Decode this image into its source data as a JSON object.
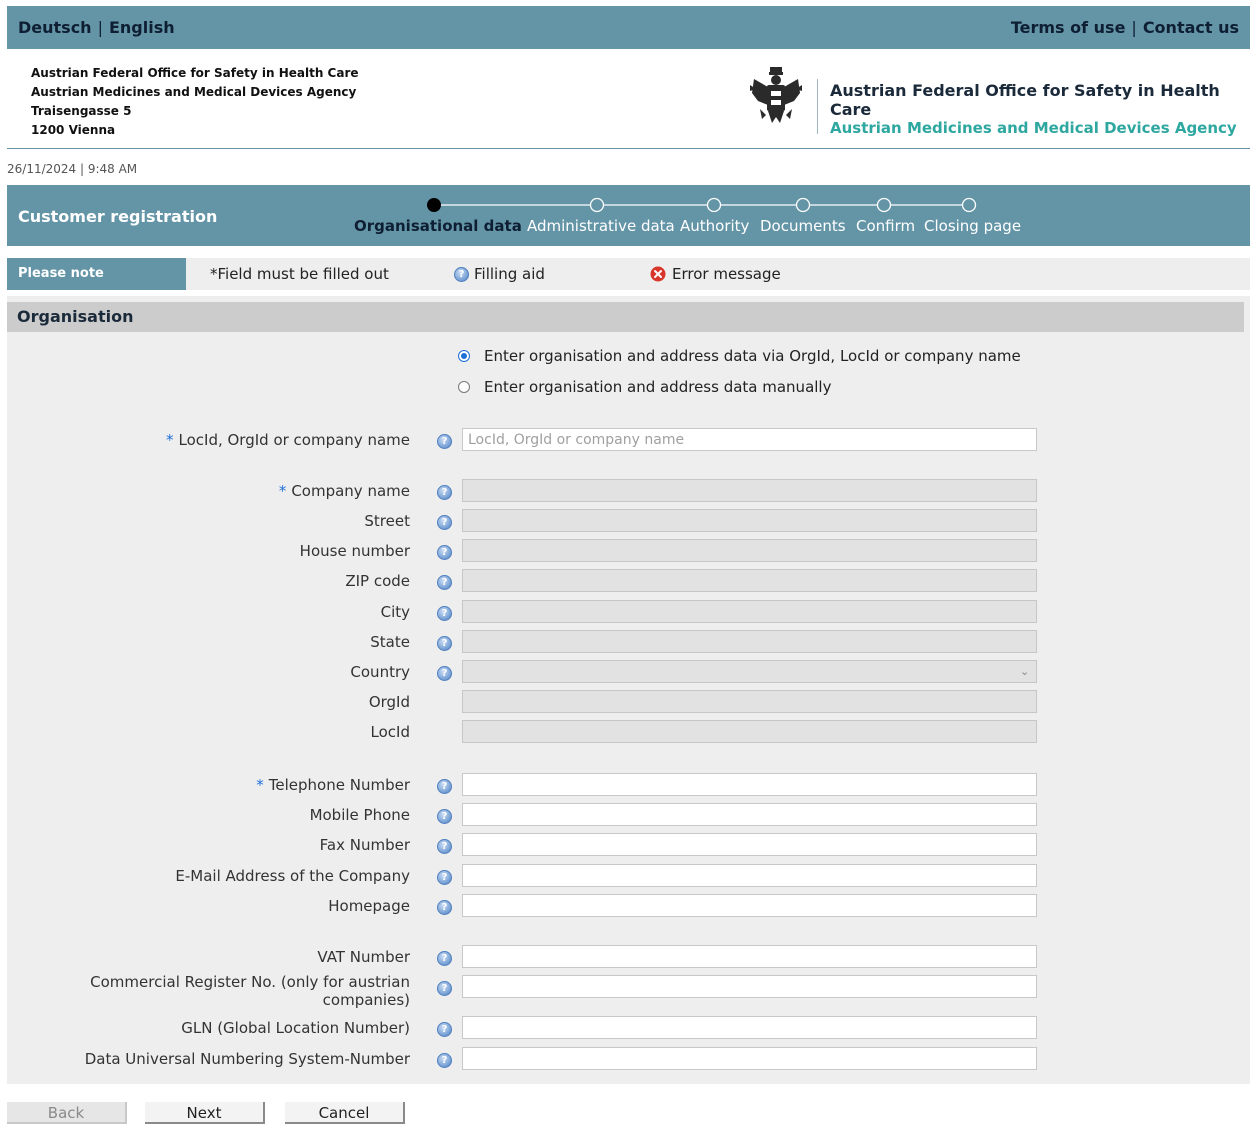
{
  "topbar": {
    "lang_de": "Deutsch",
    "lang_sep": "|",
    "lang_en": "English",
    "terms": "Terms of use",
    "link_sep": "|",
    "contact": "Contact us",
    "color": "#6495a7"
  },
  "header": {
    "address": [
      "Austrian Federal Office for Safety in Health Care",
      "Austrian Medicines and Medical Devices Agency",
      "Traisengasse 5",
      "1200 Vienna"
    ],
    "agency_line1": "Austrian Federal Office for Safety in Health Care",
    "agency_line2": "Austrian Medicines and Medical Devices Agency",
    "logo_icon": "austrian-eagle-coat-of-arms-icon"
  },
  "datetime": "26/11/2024 | 9:48 AM",
  "wizard": {
    "title": "Customer registration",
    "steps": [
      {
        "label": "Organisational data",
        "active": true
      },
      {
        "label": "Administrative data",
        "active": false
      },
      {
        "label": "Authority",
        "active": false
      },
      {
        "label": "Documents",
        "active": false
      },
      {
        "label": "Confirm",
        "active": false
      },
      {
        "label": "Closing page",
        "active": false
      }
    ]
  },
  "note": {
    "heading": "Please note",
    "required": "*Field must be filled out",
    "filling_aid": "Filling aid",
    "error_message": "Error message"
  },
  "section": {
    "title": "Organisation"
  },
  "mode": {
    "option_lookup": "Enter organisation and address data via OrgId, LocId or company name",
    "option_manual": "Enter organisation and address data manually",
    "selected": "lookup"
  },
  "fields": {
    "lookup": {
      "label": "LocId, OrgId or company name",
      "required": true,
      "placeholder": "LocId, OrgId or company name",
      "value": ""
    },
    "company_name": {
      "label": "Company name",
      "required": true,
      "value": ""
    },
    "street": {
      "label": "Street",
      "value": ""
    },
    "house_number": {
      "label": "House number",
      "value": ""
    },
    "zip": {
      "label": "ZIP code",
      "value": ""
    },
    "city": {
      "label": "City",
      "value": ""
    },
    "state": {
      "label": "State",
      "value": ""
    },
    "country": {
      "label": "Country",
      "value": ""
    },
    "orgid": {
      "label": "OrgId",
      "value": ""
    },
    "locid": {
      "label": "LocId",
      "value": ""
    },
    "telephone": {
      "label": "Telephone Number",
      "required": true,
      "value": ""
    },
    "mobile": {
      "label": "Mobile Phone",
      "value": ""
    },
    "fax": {
      "label": "Fax Number",
      "value": ""
    },
    "email": {
      "label": "E-Mail Address of the Company",
      "value": ""
    },
    "homepage": {
      "label": "Homepage",
      "value": ""
    },
    "vat": {
      "label": "VAT Number",
      "value": ""
    },
    "commercial_register_l1": "Commercial Register No. (only for austrian",
    "commercial_register_l2": "companies)",
    "gln": {
      "label": "GLN (Global Location Number)",
      "value": ""
    },
    "duns": {
      "label": "Data Universal Numbering System-Number",
      "value": ""
    }
  },
  "buttons": {
    "back": "Back",
    "next": "Next",
    "cancel": "Cancel"
  }
}
